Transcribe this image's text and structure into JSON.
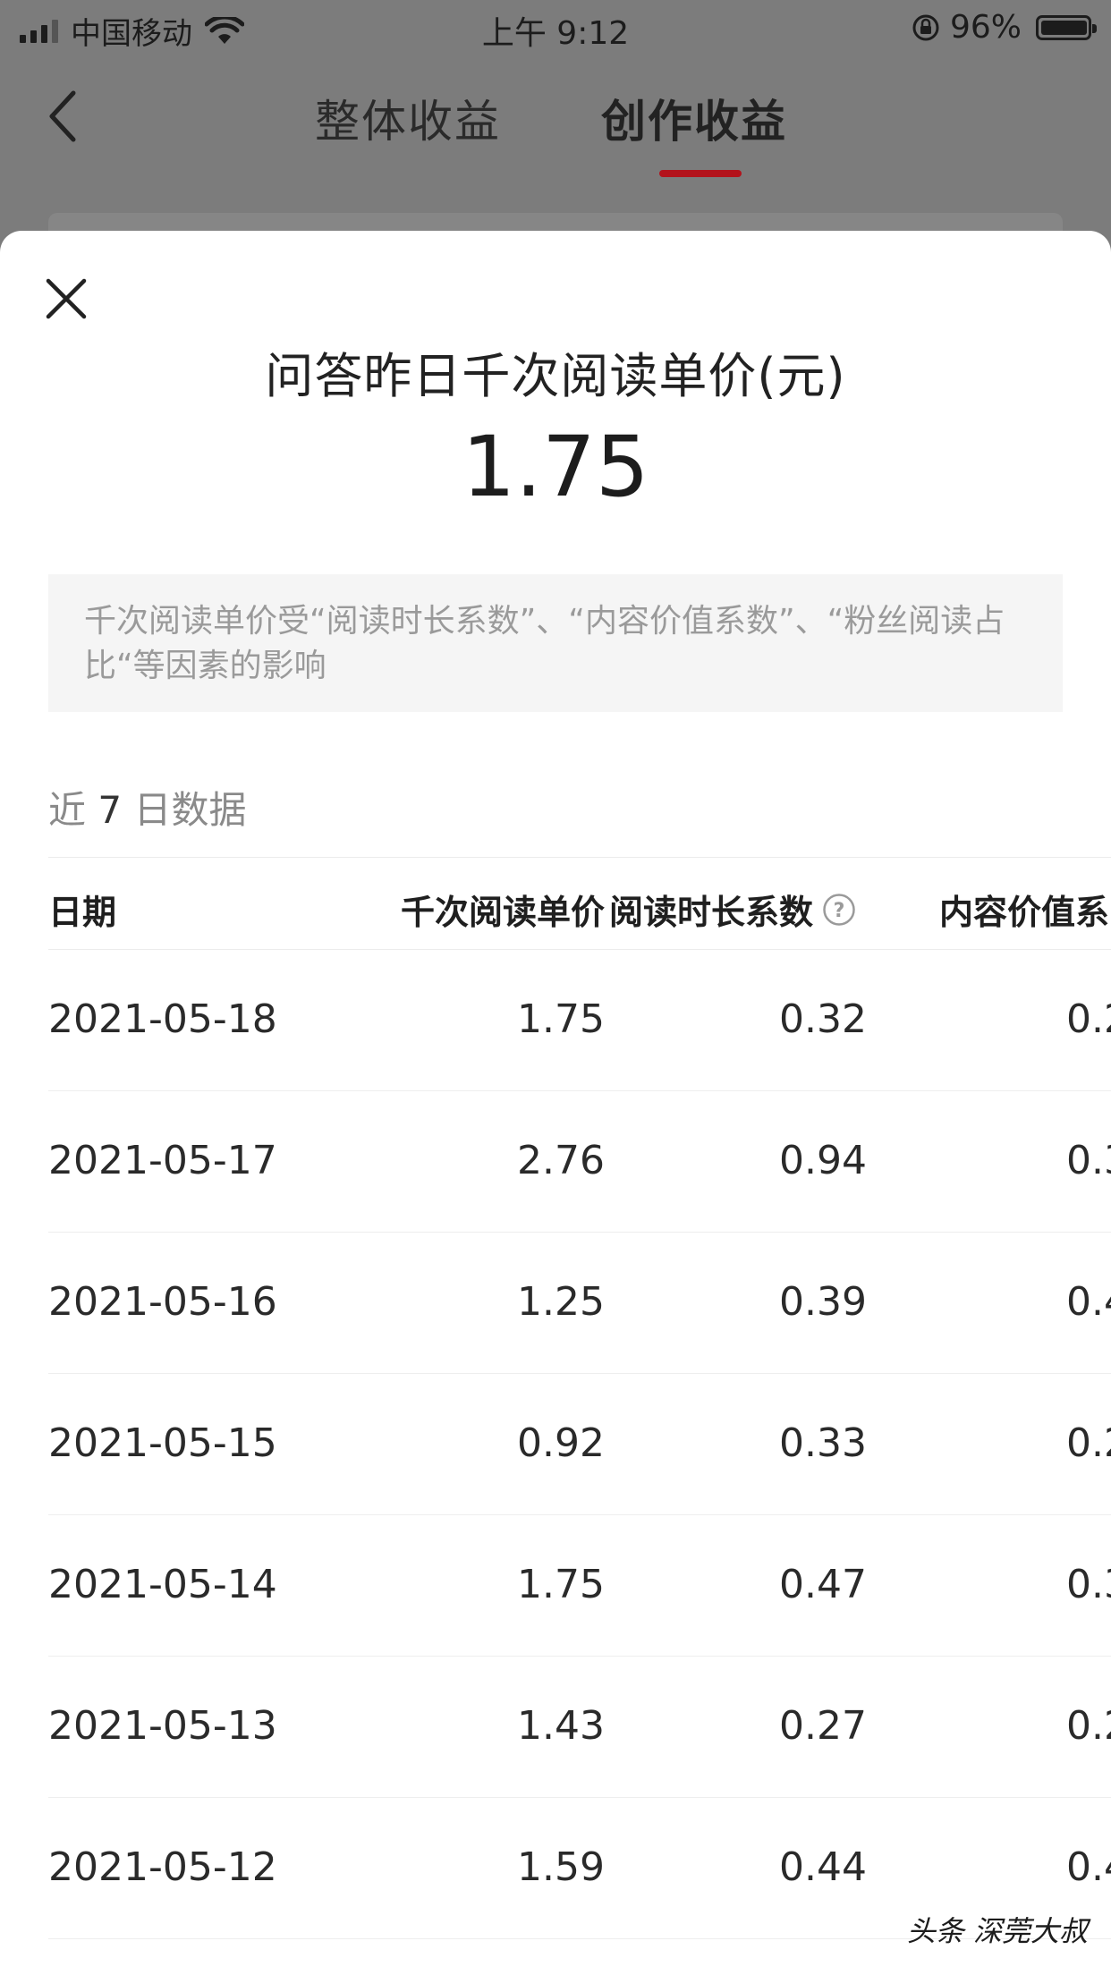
{
  "status_bar": {
    "carrier": "中国移动",
    "time": "上午 9:12",
    "battery": "96%"
  },
  "nav": {
    "tabs": [
      {
        "label": "整体收益",
        "active": false
      },
      {
        "label": "创作收益",
        "active": true
      }
    ],
    "accent_color": "#b3121b"
  },
  "sheet": {
    "title": "问答昨日千次阅读单价(元)",
    "value": "1.75",
    "notice": "千次阅读单价受“阅读时长系数”、“内容价值系数”、“粉丝阅读占比“等因素的影响",
    "section": {
      "prefix": "近",
      "num": "7",
      "suffix": "日数据"
    },
    "table": {
      "headers": {
        "date": "日期",
        "price": "千次阅读单价",
        "read": "阅读时长系数",
        "content": "内容价值系"
      },
      "rows": [
        {
          "date": "2021-05-18",
          "price": "1.75",
          "read": "0.32",
          "content": "0.2"
        },
        {
          "date": "2021-05-17",
          "price": "2.76",
          "read": "0.94",
          "content": "0.3"
        },
        {
          "date": "2021-05-16",
          "price": "1.25",
          "read": "0.39",
          "content": "0.4"
        },
        {
          "date": "2021-05-15",
          "price": "0.92",
          "read": "0.33",
          "content": "0.2"
        },
        {
          "date": "2021-05-14",
          "price": "1.75",
          "read": "0.47",
          "content": "0.3"
        },
        {
          "date": "2021-05-13",
          "price": "1.43",
          "read": "0.27",
          "content": "0.2"
        },
        {
          "date": "2021-05-12",
          "price": "1.59",
          "read": "0.44",
          "content": "0.4"
        }
      ]
    }
  },
  "watermark": "头条 深莞大叔"
}
